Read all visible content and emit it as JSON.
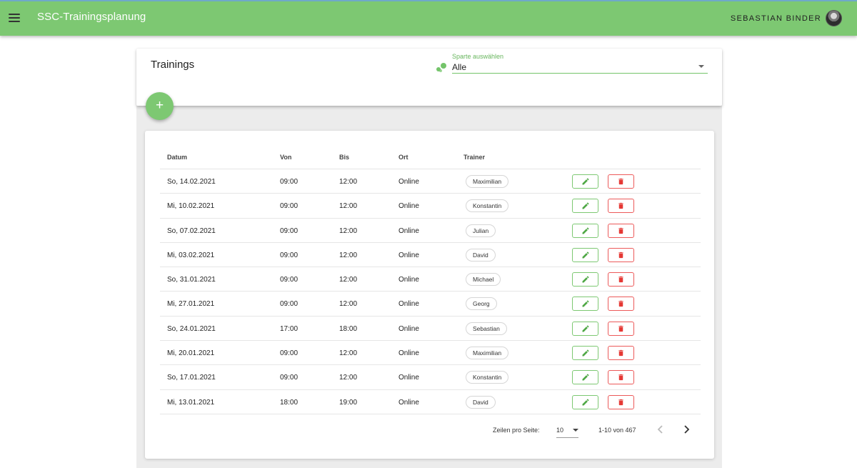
{
  "app": {
    "title": "SSC-Trainingsplanung",
    "user_name": "SEBASTIAN BINDER",
    "accent_color": "#7dc872",
    "danger_color": "#ec5a5a"
  },
  "header": {
    "title": "Trainings",
    "sparte": {
      "label": "Sparte auswählen",
      "value": "Alle"
    },
    "add_button_icon": "+"
  },
  "table": {
    "columns": [
      "Datum",
      "Von",
      "Bis",
      "Ort",
      "Trainer"
    ],
    "rows": [
      {
        "datum": "So, 14.02.2021",
        "von": "09:00",
        "bis": "12:00",
        "ort": "Online",
        "trainer": "Maximilian"
      },
      {
        "datum": "Mi, 10.02.2021",
        "von": "09:00",
        "bis": "12:00",
        "ort": "Online",
        "trainer": "Konstantin"
      },
      {
        "datum": "So, 07.02.2021",
        "von": "09:00",
        "bis": "12:00",
        "ort": "Online",
        "trainer": "Julian"
      },
      {
        "datum": "Mi, 03.02.2021",
        "von": "09:00",
        "bis": "12:00",
        "ort": "Online",
        "trainer": "David"
      },
      {
        "datum": "So, 31.01.2021",
        "von": "09:00",
        "bis": "12:00",
        "ort": "Online",
        "trainer": "Michael"
      },
      {
        "datum": "Mi, 27.01.2021",
        "von": "09:00",
        "bis": "12:00",
        "ort": "Online",
        "trainer": "Georg"
      },
      {
        "datum": "So, 24.01.2021",
        "von": "17:00",
        "bis": "18:00",
        "ort": "Online",
        "trainer": "Sebastian"
      },
      {
        "datum": "Mi, 20.01.2021",
        "von": "09:00",
        "bis": "12:00",
        "ort": "Online",
        "trainer": "Maximilian"
      },
      {
        "datum": "So, 17.01.2021",
        "von": "09:00",
        "bis": "12:00",
        "ort": "Online",
        "trainer": "Konstantin"
      },
      {
        "datum": "Mi, 13.01.2021",
        "von": "18:00",
        "bis": "19:00",
        "ort": "Online",
        "trainer": "David"
      }
    ],
    "row_icons": {
      "edit": "pencil-icon",
      "delete": "trash-icon"
    }
  },
  "pagination": {
    "rows_per_page_label": "Zeilen pro Seite:",
    "rows_per_page": "10",
    "range_text": "1-10 von 467"
  }
}
